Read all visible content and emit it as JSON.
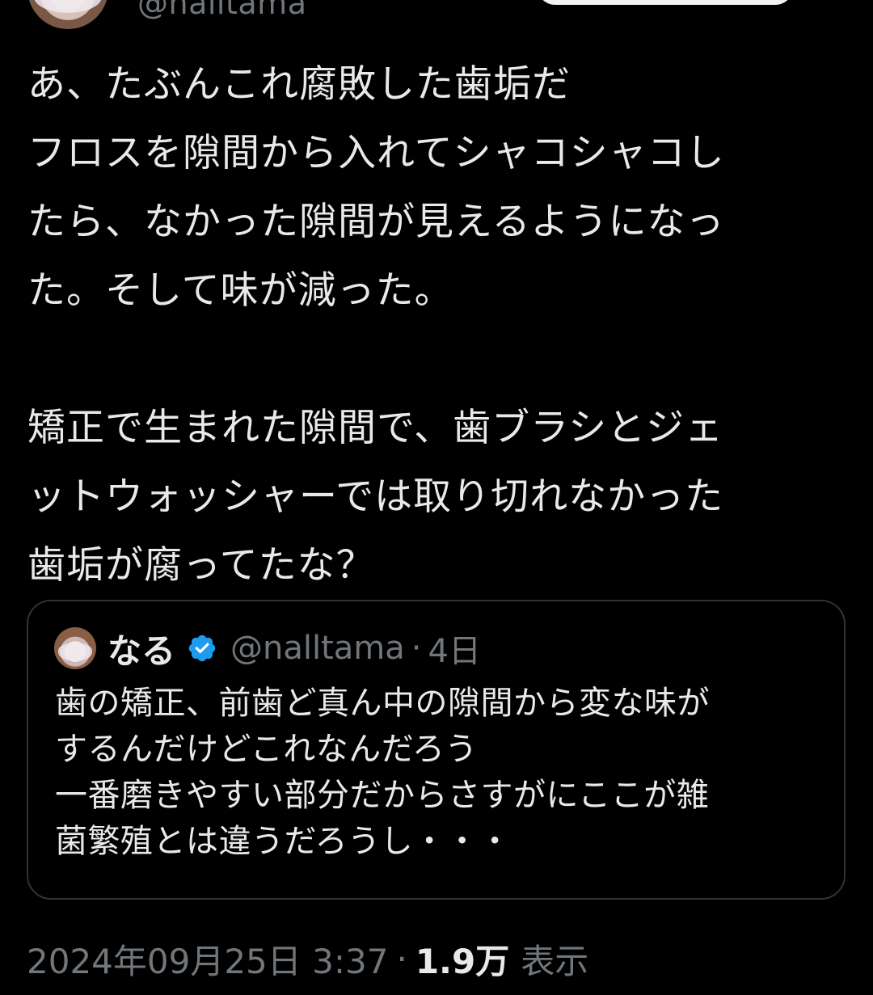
{
  "author": {
    "handle": "@nalltama"
  },
  "tweet": {
    "lines": [
      "あ、たぶんこれ腐敗した歯垢だ",
      "フロスを隙間から入れてシャコシャコし",
      "たら、なかった隙間が見えるようになっ",
      "た。そして味が減った。",
      "",
      "矯正で生まれた隙間で、歯ブラシとジェ",
      "ットウォッシャーでは取り切れなかった",
      "歯垢が腐ってたな？"
    ]
  },
  "quote": {
    "name": "なる",
    "handle": "@nalltama",
    "separator": "·",
    "time": "4日",
    "lines": [
      "歯の矯正、前歯ど真ん中の隙間から変な味が",
      "するんだけどこれなんだろう",
      "一番磨きやすい部分だからさすがにここが雑",
      "菌繁殖とは違うだろうし・・・"
    ]
  },
  "meta": {
    "datetime": "2024年09月25日 3:37",
    "separator": "·",
    "views_count": "1.9万",
    "views_label": "表示"
  },
  "colors": {
    "background": "#000000",
    "text": "#e7e9ea",
    "muted": "#71767b",
    "border": "#2f3336",
    "verified": "#1d9bf0"
  },
  "icons": {
    "verified": "verified-badge-icon"
  }
}
